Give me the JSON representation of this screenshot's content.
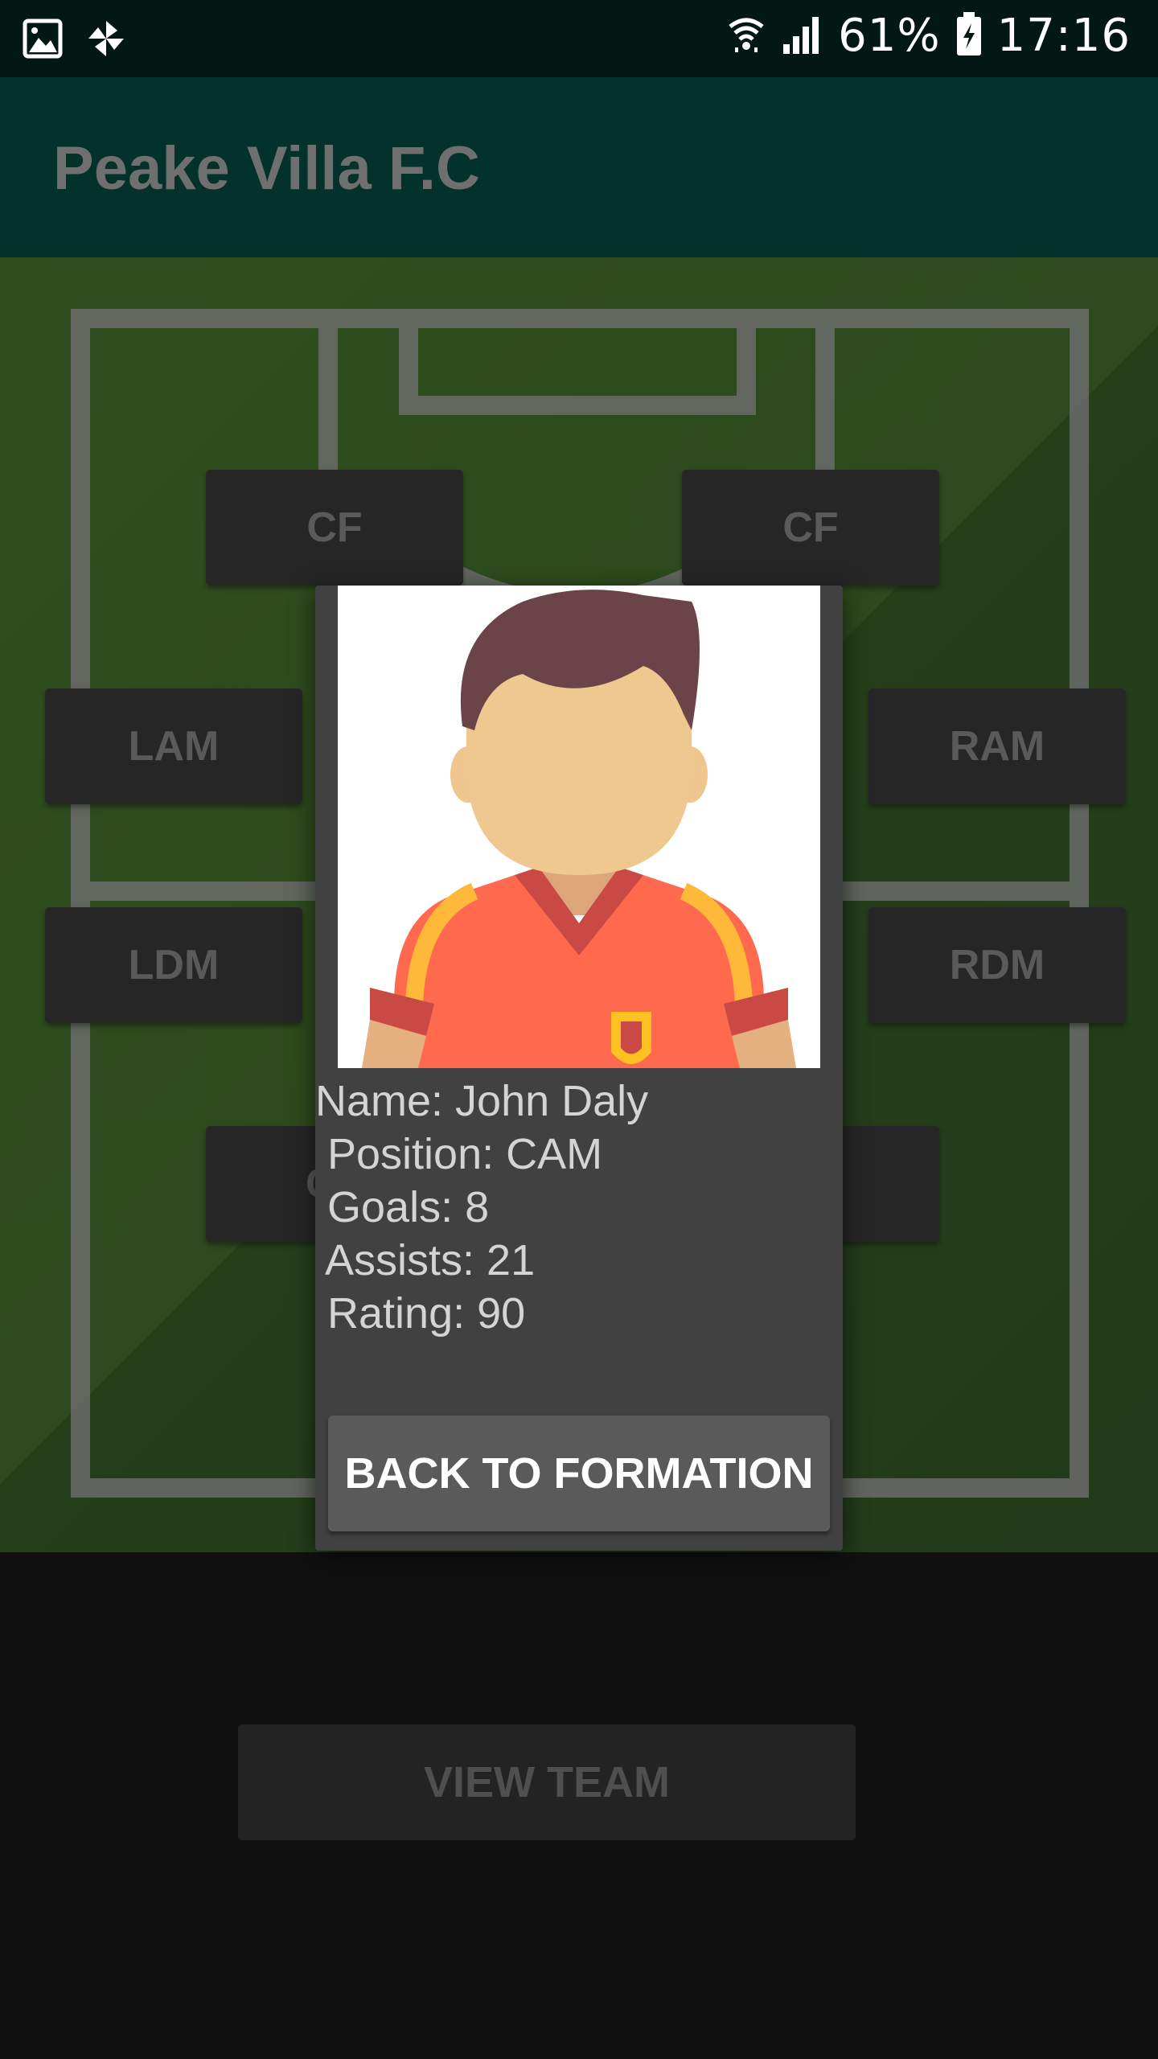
{
  "status_bar": {
    "battery": "61%",
    "time": "17:16",
    "icons": [
      "image-icon",
      "pinwheel-icon",
      "wifi-icon",
      "signal-icon",
      "battery-icon"
    ]
  },
  "app_bar": {
    "title": "Peake Villa F.C"
  },
  "formation": {
    "positions": [
      "CF",
      "CF",
      "LAM",
      "RAM",
      "LDM",
      "RDM",
      "C",
      ""
    ]
  },
  "bottom": {
    "view_team_label": "VIEW TEAM"
  },
  "dialog": {
    "name": "Name: John Daly",
    "position": " Position: CAM",
    "goals": " Goals: 8",
    "assists": " Assists: 21",
    "rating": " Rating: 90",
    "back_label": "BACK TO FORMATION"
  }
}
